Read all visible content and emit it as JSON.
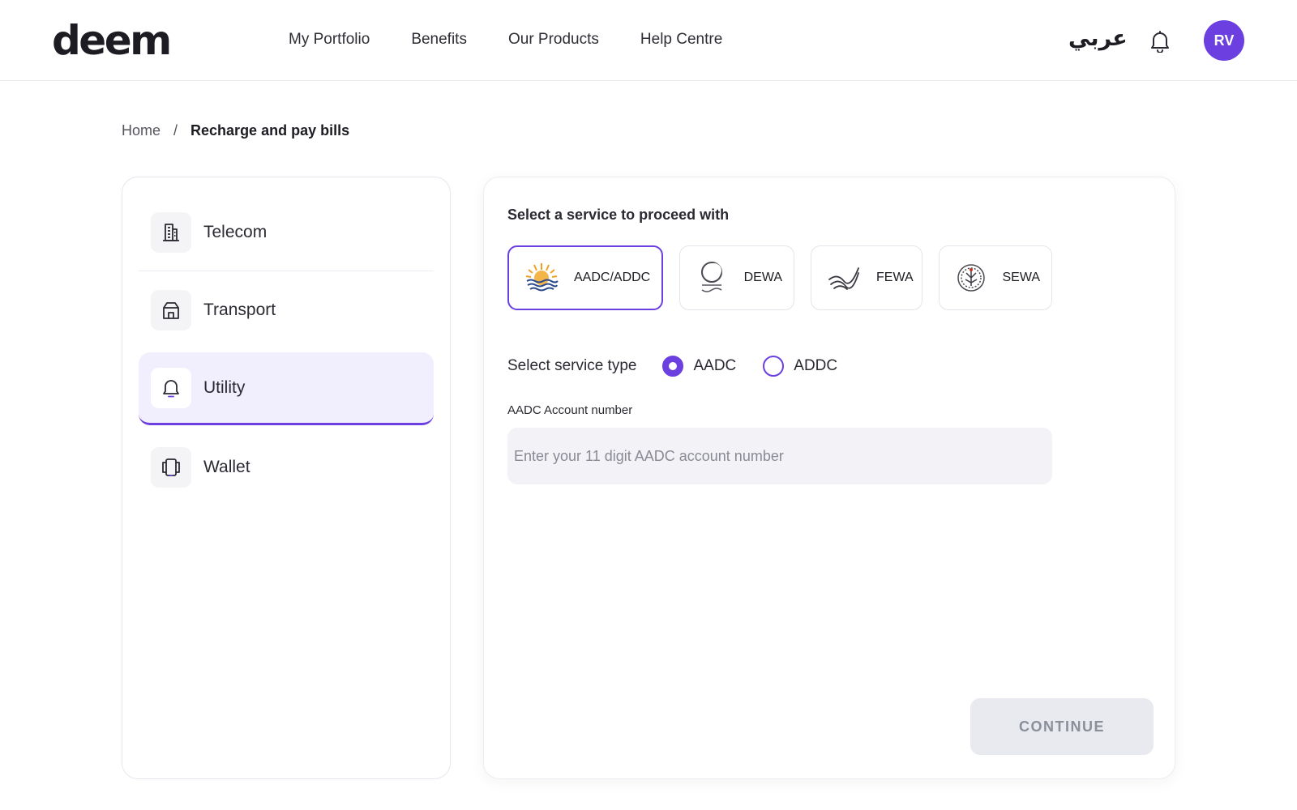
{
  "brand": {
    "logo_text": "deem",
    "accent": "#6b3fe0"
  },
  "header": {
    "nav": [
      {
        "label": "My Portfolio"
      },
      {
        "label": "Benefits"
      },
      {
        "label": "Our Products"
      },
      {
        "label": "Help Centre"
      }
    ],
    "language_label": "عربي",
    "notification_icon": "bell-icon",
    "avatar_initials": "RV"
  },
  "breadcrumb": {
    "home": "Home",
    "separator": "/",
    "current": "Recharge and pay bills"
  },
  "sidebar": {
    "items": [
      {
        "label": "Telecom",
        "icon": "building-icon",
        "active": false
      },
      {
        "label": "Transport",
        "icon": "house-icon",
        "active": false
      },
      {
        "label": "Utility",
        "icon": "bell-icon",
        "active": true
      },
      {
        "label": "Wallet",
        "icon": "wallet-icon",
        "active": false
      }
    ]
  },
  "main": {
    "title": "Select a service to proceed with",
    "services": [
      {
        "label": "AADC/ADDC",
        "icon": "aadc-logo",
        "selected": true
      },
      {
        "label": "DEWA",
        "icon": "dewa-logo",
        "selected": false
      },
      {
        "label": "FEWA",
        "icon": "fewa-logo",
        "selected": false
      },
      {
        "label": "SEWA",
        "icon": "sewa-logo",
        "selected": false
      }
    ],
    "service_type": {
      "label": "Select service type",
      "options": [
        {
          "label": "AADC",
          "checked": true
        },
        {
          "label": "ADDC",
          "checked": false
        }
      ]
    },
    "account": {
      "label": "AADC Account number",
      "value": "",
      "placeholder": "Enter your 11 digit AADC account number"
    },
    "continue_label": "CONTINUE"
  }
}
